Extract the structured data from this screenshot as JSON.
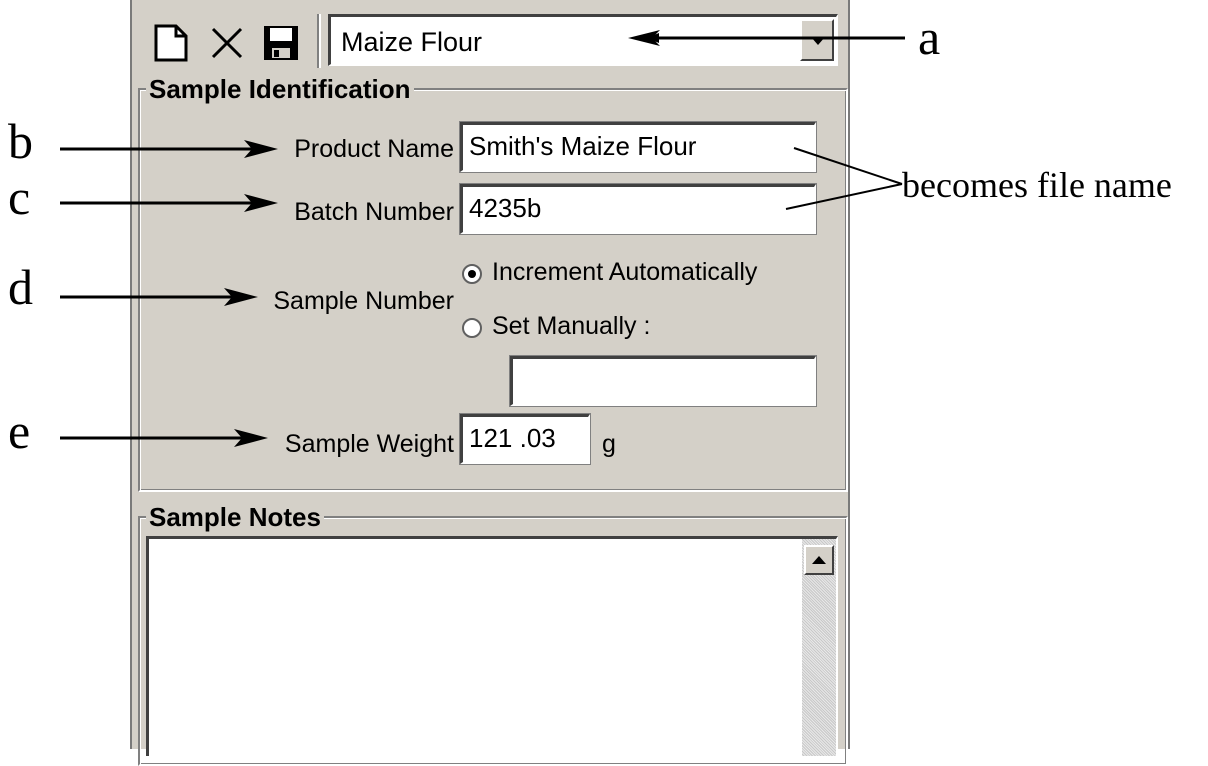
{
  "toolbar": {
    "new_icon": "new-document-icon",
    "delete_icon": "delete-x-icon",
    "save_icon": "save-disk-icon"
  },
  "sample_select": {
    "value": "Maize Flour"
  },
  "sample_identification": {
    "title": "Sample Identification",
    "product_name_label": "Product Name",
    "product_name_value": "Smith's Maize Flour",
    "batch_number_label": "Batch Number",
    "batch_number_value": "4235b",
    "sample_number_label": "Sample Number",
    "increment_label": "Increment Automatically",
    "increment_selected": true,
    "manual_label": "Set Manually :",
    "manual_value": "",
    "sample_weight_label": "Sample Weight",
    "sample_weight_value": "121 .03",
    "sample_weight_unit": "g"
  },
  "sample_notes": {
    "title": "Sample Notes",
    "value": ""
  },
  "annotations": {
    "a": "a",
    "b": "b",
    "c": "c",
    "d": "d",
    "e": "e",
    "file_name_note": "becomes file name"
  }
}
